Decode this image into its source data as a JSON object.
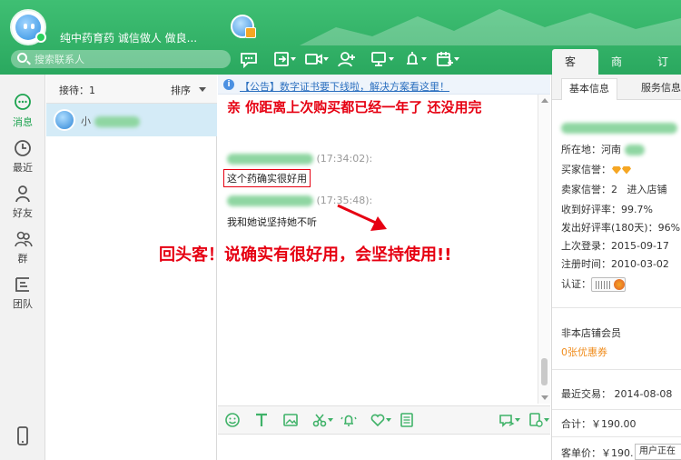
{
  "header": {
    "shop_name": "纯中药育药  诚信做人 做良...",
    "search_placeholder": "搜索联系人"
  },
  "right_tabs": [
    "客户",
    "商品",
    "订"
  ],
  "sidebar": {
    "items": [
      {
        "label": "消息"
      },
      {
        "label": "最近"
      },
      {
        "label": "好友"
      },
      {
        "label": "群"
      },
      {
        "label": "团队"
      }
    ]
  },
  "contacts": {
    "reception_label": "接待：1",
    "sort_label": "排序",
    "items": [
      {
        "name": "小"
      }
    ]
  },
  "chat": {
    "notice": "【公告】数字证书要下线啦，解决方案看这里！",
    "red_note": "亲  你距离上次购买都已经一年了  还没用完",
    "messages": [
      {
        "time": "(17:34:02):",
        "text": "这个药确实很好用"
      },
      {
        "time": "(17:35:48):",
        "text": "我和她说坚持她不听"
      }
    ],
    "callout": "回头客！说确实有很好用，会坚持使用!!"
  },
  "customer_panel": {
    "tabs": [
      "基本信息",
      "服务信息"
    ],
    "location": "所在地：河南",
    "buyer_credit": "买家信誉：",
    "seller_credit": "卖家信誉：2",
    "enter_shop": "进入店铺",
    "received_rate": "收到好评率：99.7%",
    "sent_rate": "发出好评率(180天)：96%",
    "last_login": "上次登录：2015-09-17",
    "registered": "注册时间：2010-03-02",
    "auth": "认证：",
    "member": "非本店铺会员",
    "coupons": "0张优惠券",
    "last_trade": "最近交易：  2014-08-08",
    "total": "合计：￥190.00",
    "unit_price": "客单价：￥190.",
    "tooltip": "用户正在"
  },
  "colors": {
    "brand": "#2aa85f",
    "alert": "#e60012",
    "link": "#2b6fbf",
    "selected_row": "#d4ebf7",
    "coupon": "#f08c1c"
  }
}
